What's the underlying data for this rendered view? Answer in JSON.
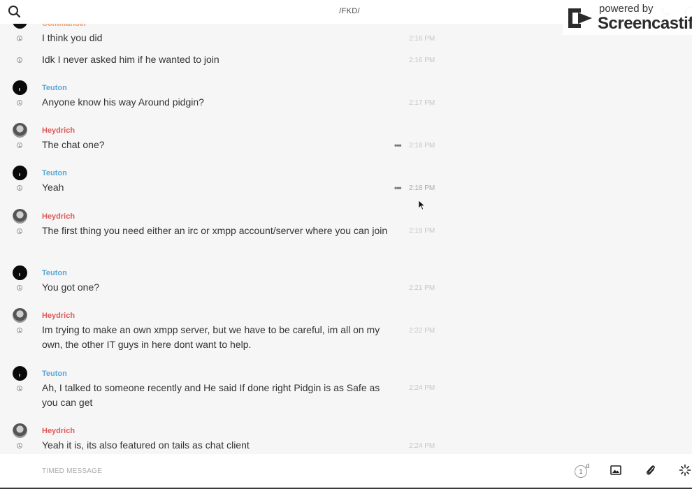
{
  "header": {
    "title": "/FKD/"
  },
  "watermark": {
    "line1": "powered by",
    "line2": "Screencastify"
  },
  "colors": {
    "teuton": "#5aa7d6",
    "heydrich": "#e05a5a",
    "commander": "#f0a070"
  },
  "messages": [
    {
      "author": "Commander",
      "text": "I think you did",
      "time": "2:16 PM"
    },
    {
      "author": "",
      "text": "Idk I never asked him if he wanted to join",
      "time": "2:16 PM"
    },
    {
      "author": "Teuton",
      "text": "Anyone know his way Around pidgin?",
      "time": "2:17 PM"
    },
    {
      "author": "Heydrich",
      "text": "The chat one?",
      "time": "2:18 PM"
    },
    {
      "author": "Teuton",
      "text": "Yeah",
      "time": "2:18 PM"
    },
    {
      "author": "Heydrich",
      "text": "The first thing you need either an irc or xmpp account/server where you can join",
      "time": "2:19 PM"
    },
    {
      "author": "Teuton",
      "text": "You got one?",
      "time": "2:21 PM"
    },
    {
      "author": "Heydrich",
      "text": "Im trying to make an own xmpp server, but we have to be careful, im all on my own, the other IT guys in here dont want to help.",
      "time": "2:22 PM"
    },
    {
      "author": "Teuton",
      "text": "Ah, I talked to someone recently and He said If done right Pidgin is as Safe as you can get",
      "time": "2:24 PM"
    },
    {
      "author": "Heydrich",
      "text": "Yeah it is, its also featured on tails as chat client",
      "time": "2:24 PM"
    }
  ],
  "composer": {
    "placeholder": "TIMED MESSAGE",
    "timer_value": "1",
    "timer_unit": "d"
  },
  "icons": {
    "search": "search-icon",
    "call": "phone-icon",
    "info": "info-icon",
    "image": "image-icon",
    "attach": "paperclip-icon",
    "loading": "spinner-icon",
    "more": "more-dots-icon",
    "status": "clock-icon"
  }
}
